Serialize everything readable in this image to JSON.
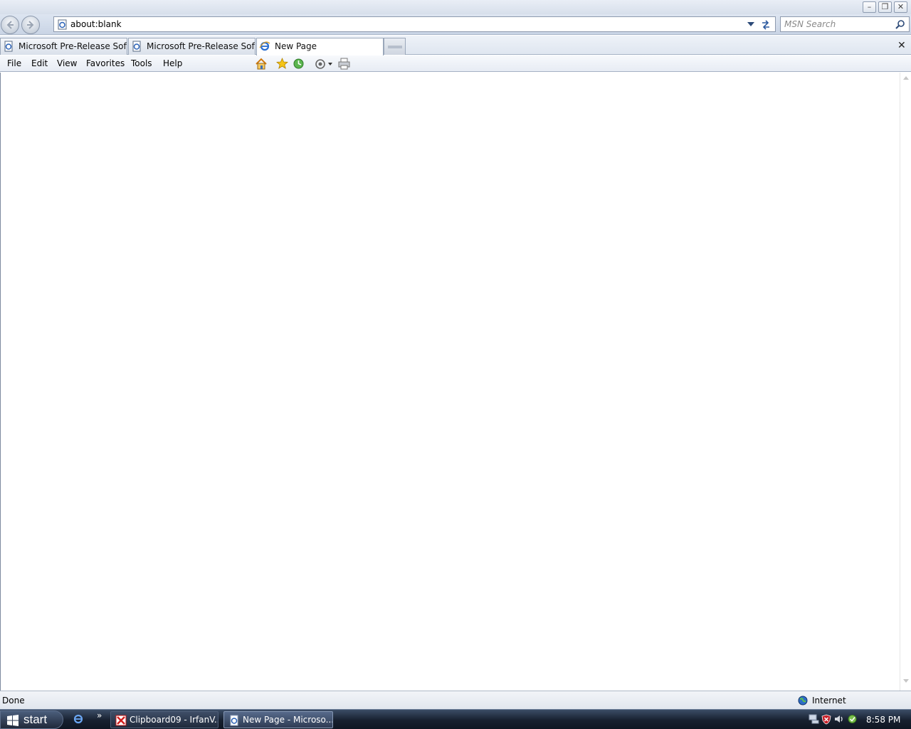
{
  "window": {
    "minimize": "–",
    "maximize": "❐",
    "close": "✕"
  },
  "address": {
    "url": "about:blank"
  },
  "search": {
    "placeholder": "MSN Search"
  },
  "tabs": [
    {
      "label": "Microsoft Pre-Release Softw",
      "active": false
    },
    {
      "label": "Microsoft Pre-Release Softw",
      "active": false
    },
    {
      "label": "New Page",
      "active": true
    }
  ],
  "tabbar": {
    "close": "✕"
  },
  "menu": {
    "file": "File",
    "edit": "Edit",
    "view": "View",
    "favorites": "Favorites",
    "tools": "Tools",
    "help": "Help"
  },
  "status": {
    "text": "Done",
    "zone": "Internet"
  },
  "taskbar": {
    "start": "start",
    "more": "»",
    "tasks": [
      {
        "label": "Clipboard09 - IrfanV..."
      },
      {
        "label": "New Page - Microso..."
      }
    ],
    "clock": "8:58 PM"
  },
  "colors": {
    "chrome": "#d7dfeb",
    "taskbar": "#17202f",
    "active_tab": "#ffffff"
  }
}
